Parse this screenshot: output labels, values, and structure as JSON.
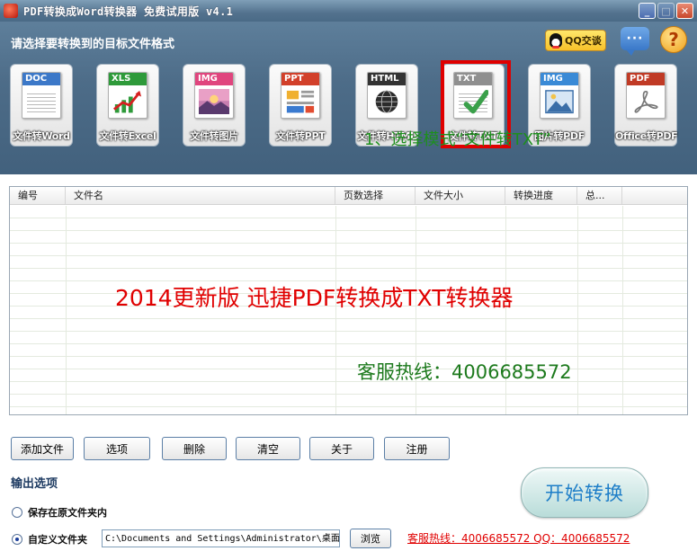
{
  "window": {
    "title": "PDF转换成Word转换器 免费试用版 v4.1",
    "minimize_glyph": "_",
    "maximize_glyph": "□",
    "close_glyph": "✕"
  },
  "header": {
    "instruction": "请选择要转换到的目标文件格式",
    "qq_label": "QQ交谈",
    "chat_glyph": "···",
    "help_glyph": "?"
  },
  "formats": [
    {
      "tag": "DOC",
      "label": "文件转Word",
      "tag_color": "#3c78c8",
      "icon": "word-doc-icon"
    },
    {
      "tag": "XLS",
      "label": "文件转Excel",
      "tag_color": "#2e9a3a",
      "icon": "excel-chart-icon"
    },
    {
      "tag": "IMG",
      "label": "文件转图片",
      "tag_color": "#e0457e",
      "icon": "image-landscape-icon"
    },
    {
      "tag": "PPT",
      "label": "文件转PPT",
      "tag_color": "#d2402a",
      "icon": "ppt-slides-icon"
    },
    {
      "tag": "HTML",
      "label": "文件转HTML",
      "tag_color": "#333333",
      "icon": "html-globe-icon"
    },
    {
      "tag": "TXT",
      "label": "文件转TXT",
      "tag_color": "#8f8f8f",
      "icon": "txt-check-icon"
    },
    {
      "tag": "IMG",
      "label": "图片转PDF",
      "tag_color": "#3a8ad6",
      "icon": "picture-to-pdf-icon"
    },
    {
      "tag": "PDF",
      "label": "Office转PDF",
      "tag_color": "#c03a25",
      "icon": "office-pdf-icon"
    }
  ],
  "selected_format_index": 5,
  "hint": "1、选择模式“文件转TXT”",
  "list": {
    "columns": [
      "编号",
      "文件名",
      "页数选择",
      "文件大小",
      "转换进度",
      "总..."
    ],
    "promo_title": "2014更新版  迅捷PDF转换成TXT转换器",
    "promo_phone": "客服热线：4006685572"
  },
  "toolbar": {
    "add_file": "添加文件",
    "options": "选项",
    "delete": "删除",
    "clear": "清空",
    "about": "关于",
    "register": "注册"
  },
  "output": {
    "title": "输出选项",
    "save_original": "保存在原文件夹内",
    "custom_folder": "自定义文件夹",
    "path": "C:\\Documents and Settings\\Administrator\\桌面",
    "browse": "浏览",
    "selected": "custom"
  },
  "footer": {
    "hotline": "客服热线：4006685572 QQ：4006685572",
    "start": "开始转换"
  },
  "colors": {
    "accent_red": "#e00000",
    "hint_green": "#1d8f1d",
    "start_text": "#1e7ec8"
  }
}
